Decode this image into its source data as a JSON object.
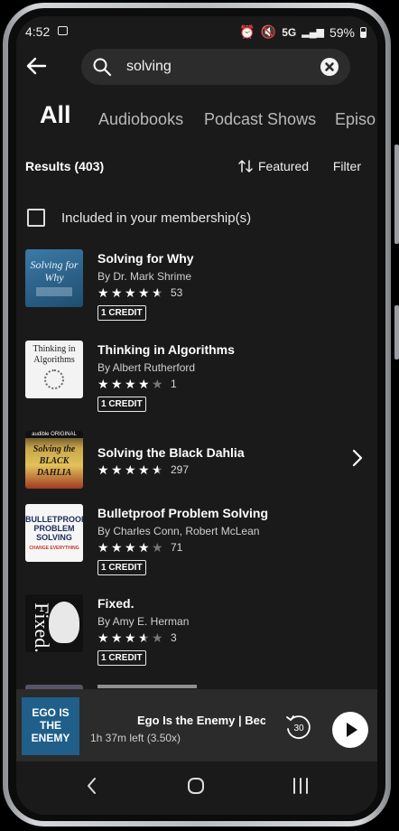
{
  "status": {
    "time": "4:52",
    "network": "5G",
    "battery": "59%"
  },
  "search": {
    "query": "solving"
  },
  "tabs": [
    {
      "label": "All"
    },
    {
      "label": "Audiobooks"
    },
    {
      "label": "Podcast Shows"
    },
    {
      "label": "Episo"
    }
  ],
  "results": {
    "count_label": "Results (403)",
    "sort_label": "Featured",
    "filter_label": "Filter"
  },
  "membership": {
    "label": "Included in your membership(s)",
    "checked": false
  },
  "items": [
    {
      "title": "Solving for Why",
      "author": "By Dr. Mark Shrime",
      "rating": 4.5,
      "rating_count": "53",
      "credit": "1 CREDIT",
      "cover_text": "Solving for Why"
    },
    {
      "title": "Thinking in Algorithms",
      "author": "By Albert Rutherford",
      "rating": 4,
      "rating_count": "1",
      "credit": "1 CREDIT",
      "cover_text": "Thinking in Algorithms"
    },
    {
      "title": "Solving the Black Dahlia",
      "rating": 4.5,
      "rating_count": "297",
      "cover_text": "Solving the BLACK DAHLIA",
      "cover_badge": "audible ORIGINAL"
    },
    {
      "title": "Bulletproof Problem Solving",
      "author": "By Charles Conn, Robert McLean",
      "rating": 4,
      "rating_count": "71",
      "credit": "1 CREDIT",
      "cover_text": "BULLETPROOF PROBLEM SOLVING",
      "cover_sub": "CHANGE EVERYTHING"
    },
    {
      "title": "Fixed.",
      "author": "By Amy E. Herman",
      "rating": 3.5,
      "rating_count": "3",
      "credit": "1 CREDIT",
      "cover_text": "Fixed."
    }
  ],
  "player": {
    "title": "Ego Is the Enemy | Bec",
    "subtitle": "1h 37m left (3.50x)",
    "skip_seconds": "30",
    "cover_text": "EGO IS THE ENEMY"
  }
}
